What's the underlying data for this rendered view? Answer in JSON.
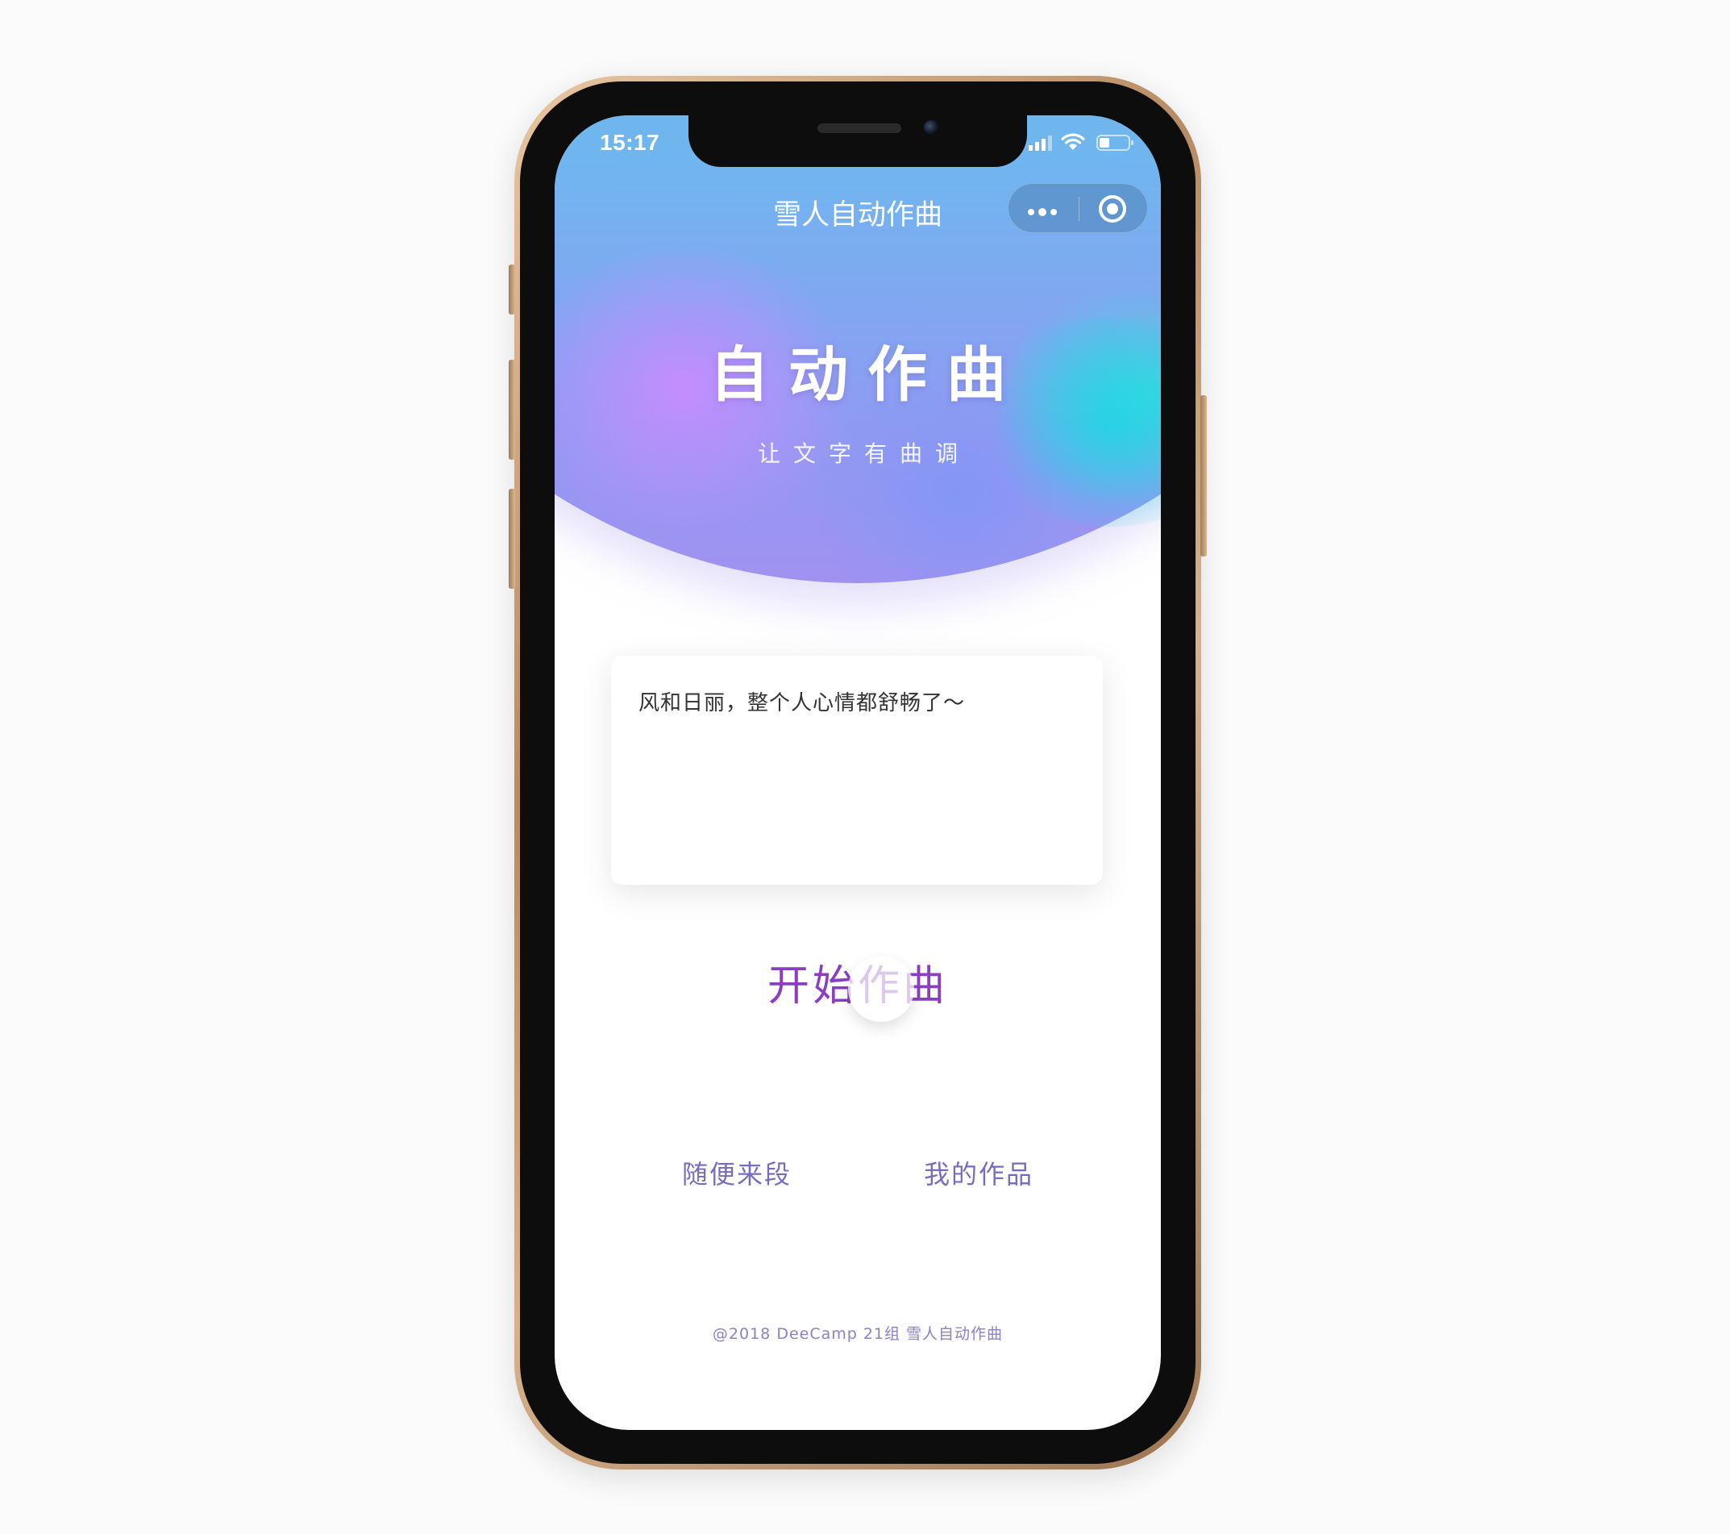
{
  "status_bar": {
    "time": "15:17"
  },
  "nav": {
    "title": "雪人自动作曲",
    "capsule": {
      "more_icon": "more-dots-icon",
      "close_icon": "target-circle-icon"
    }
  },
  "hero": {
    "title": "自动作曲",
    "subtitle": "让文字有曲调"
  },
  "input": {
    "value": "风和日丽，整个人心情都舒畅了～"
  },
  "actions": {
    "start_label": "开始作曲",
    "random_label": "随便来段",
    "my_works_label": "我的作品"
  },
  "footer": {
    "text": "@2018 DeeCamp 21组 雪人自动作曲"
  },
  "colors": {
    "accent_purple": "#8a3fc1",
    "link_purple": "#7b6bbf",
    "footer_purple": "#8f80c6",
    "hero_blue": "#69b2f0",
    "hero_violet": "#c88cff",
    "hero_cyan": "#3cdcdc"
  }
}
